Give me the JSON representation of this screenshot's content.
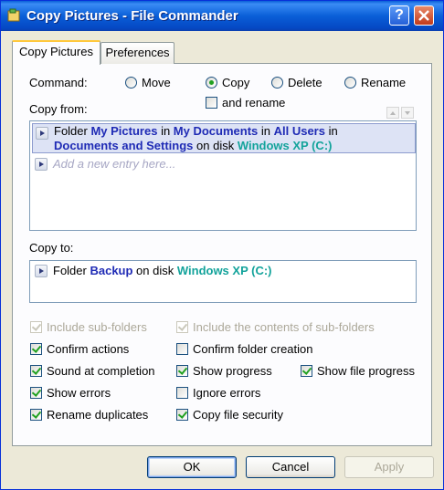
{
  "window": {
    "title": "Copy Pictures - File Commander"
  },
  "tabs": [
    {
      "label": "Copy Pictures"
    },
    {
      "label": "Preferences"
    }
  ],
  "command": {
    "label": "Command:",
    "options": [
      {
        "label": "Move",
        "selected": false
      },
      {
        "label": "Copy",
        "selected": true
      },
      {
        "label": "Delete",
        "selected": false
      },
      {
        "label": "Rename",
        "selected": false
      }
    ],
    "and_rename": {
      "label": "and rename",
      "checked": false
    }
  },
  "copy_from": {
    "label": "Copy from:",
    "entry": {
      "w1": "Folder ",
      "w2": "My Pictures",
      "w3": " in ",
      "w4": "My Documents",
      "w5": " in ",
      "w6": "All Users",
      "w7": " in",
      "w8": "Documents and Settings",
      "w9": " on disk ",
      "w10": "Windows XP (C:)"
    },
    "new_entry_placeholder": "Add a new entry here..."
  },
  "copy_to": {
    "label": "Copy to:",
    "entry": {
      "w1": "Folder ",
      "w2": "Backup",
      "w3": " on disk ",
      "w4": "Windows XP (C:)"
    }
  },
  "options": {
    "include_subfolders": {
      "label": "Include sub-folders",
      "checked": true,
      "enabled": false
    },
    "include_contents": {
      "label": "Include the contents of sub-folders",
      "checked": true,
      "enabled": false
    },
    "confirm_actions": {
      "label": "Confirm actions",
      "checked": true
    },
    "confirm_folder_creation": {
      "label": "Confirm folder creation",
      "checked": false
    },
    "sound_at_completion": {
      "label": "Sound at completion",
      "checked": true
    },
    "show_progress": {
      "label": "Show progress",
      "checked": true
    },
    "show_file_progress": {
      "label": "Show file progress",
      "checked": true
    },
    "show_errors": {
      "label": "Show errors",
      "checked": true
    },
    "ignore_errors": {
      "label": "Ignore errors",
      "checked": false
    },
    "rename_duplicates": {
      "label": "Rename duplicates",
      "checked": true
    },
    "copy_file_security": {
      "label": "Copy file security",
      "checked": true
    }
  },
  "buttons": {
    "ok": "OK",
    "cancel": "Cancel",
    "apply": "Apply"
  },
  "colors": {
    "title_bar": "#0a5fd8",
    "keyword_blue": "#1f2bb5",
    "keyword_teal": "#13a39b",
    "check_green": "#21a121"
  },
  "icons": {
    "app": "file-commander-icon",
    "help": "help-icon",
    "close": "close-icon",
    "entry_expand": "chevron-right-icon"
  }
}
